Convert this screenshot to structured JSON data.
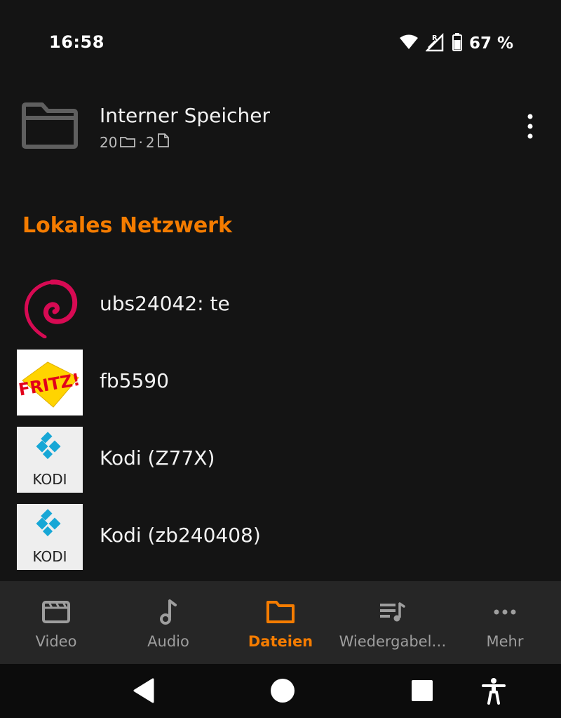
{
  "status_bar": {
    "time": "16:58",
    "battery_text": "67 %",
    "icons": [
      "wifi-icon",
      "signal-icon",
      "battery-icon"
    ]
  },
  "storage": {
    "title": "Interner Speicher",
    "folder_count": "20",
    "file_count": "2",
    "separator": "·"
  },
  "section": {
    "title": "Lokales Netzwerk"
  },
  "network_items": [
    {
      "label": "ubs24042: te",
      "icon": "debian-logo"
    },
    {
      "label": "fb5590",
      "icon": "fritz-logo"
    },
    {
      "label": "Kodi (Z77X)",
      "icon": "kodi-logo"
    },
    {
      "label": "Kodi (zb240408)",
      "icon": "kodi-logo"
    }
  ],
  "kodi_logo_text": "KODI",
  "fritz_logo_text": "FRITZ!",
  "bottom_nav": [
    {
      "label": "Video",
      "icon": "video-icon",
      "active": false
    },
    {
      "label": "Audio",
      "icon": "music-note-icon",
      "active": false
    },
    {
      "label": "Dateien",
      "icon": "folder-icon",
      "active": true
    },
    {
      "label": "Wiedergabel…",
      "icon": "playlist-icon",
      "active": false
    },
    {
      "label": "Mehr",
      "icon": "more-horizontal-icon",
      "active": false
    }
  ],
  "colors": {
    "accent": "#f57c00",
    "background": "#141414",
    "nav_background": "#262626"
  }
}
